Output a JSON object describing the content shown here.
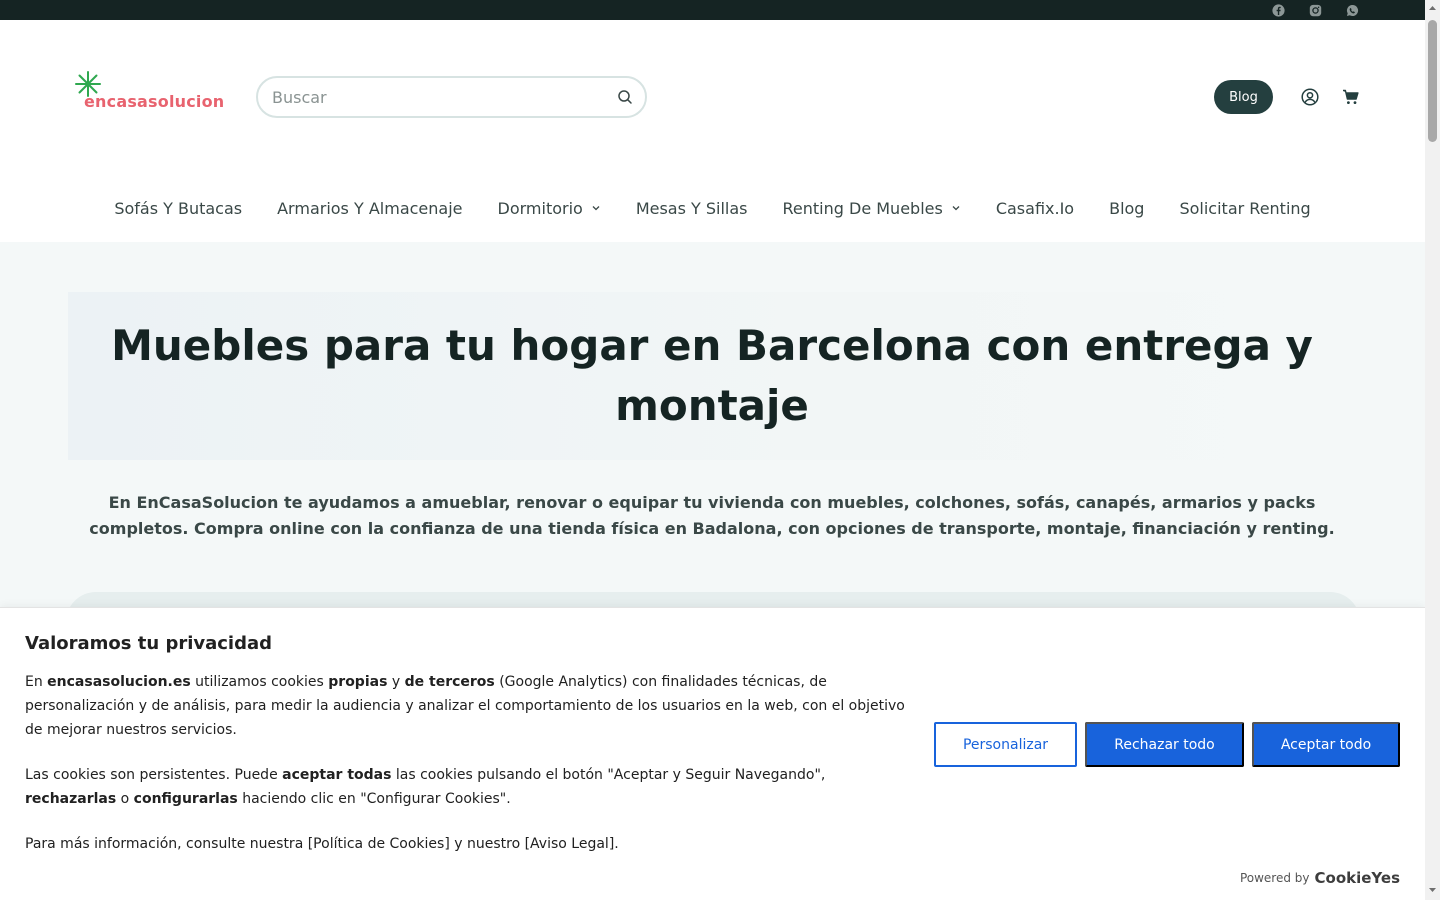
{
  "social": [
    {
      "icon": "facebook-icon"
    },
    {
      "icon": "instagram-icon"
    },
    {
      "icon": "whatsapp-icon"
    }
  ],
  "logo": {
    "text": "encasasolucion",
    "star_color": "#2fa84f",
    "text_color": "#e8636f"
  },
  "search": {
    "placeholder": "Buscar"
  },
  "header": {
    "blog_label": "Blog"
  },
  "nav": [
    {
      "label": "Sofás Y Butacas",
      "dropdown": false
    },
    {
      "label": "Armarios Y Almacenaje",
      "dropdown": false
    },
    {
      "label": "Dormitorio",
      "dropdown": true
    },
    {
      "label": "Mesas Y Sillas",
      "dropdown": false
    },
    {
      "label": "Renting De Muebles",
      "dropdown": true
    },
    {
      "label": "Casafix.Io",
      "dropdown": false
    },
    {
      "label": "Blog",
      "dropdown": false
    },
    {
      "label": "Solicitar Renting",
      "dropdown": false
    }
  ],
  "hero": {
    "title_line1": "Muebles para tu hogar en Barcelona con entrega y",
    "title_line2": "montaje",
    "description_line1": "En EnCasaSolucion te ayudamos a amueblar, renovar o equipar tu vivienda con muebles, colchones, sofás, canapés, armarios y packs",
    "description_line2": "completos. Compra online con la confianza de una tienda física en Badalona, con opciones de transporte, montaje, financiación y renting."
  },
  "cookie": {
    "title": "Valoramos tu privacidad",
    "p1": {
      "t1": "En ",
      "b1": "encasasolucion.es",
      "t2": " utilizamos cookies ",
      "b2": "propias",
      "t3": " y ",
      "b3": "de terceros",
      "t4": " (Google Analytics) con finalidades técnicas, de personalización y de análisis, para medir la audiencia y analizar el comportamiento de los usuarios en la web, con el objetivo de mejorar nuestros servicios."
    },
    "p2": {
      "t1": "Las cookies son persistentes. Puede ",
      "b1": "aceptar todas",
      "t2": " las cookies pulsando el botón \"Aceptar y Seguir Navegando\",",
      "b2": "rechazarlas",
      "t3": " o ",
      "b3": "configurarlas",
      "t4": " haciendo clic en \"Configurar Cookies\"."
    },
    "p3": "Para más información, consulte nuestra [Política de Cookies] y nuestro [Aviso Legal].",
    "buttons": {
      "customize": "Personalizar",
      "reject": "Rechazar todo",
      "accept": "Aceptar todo"
    },
    "powered_by": "Powered by",
    "powered_brand": "CookieYes",
    "accent_color": "#1863dc"
  }
}
